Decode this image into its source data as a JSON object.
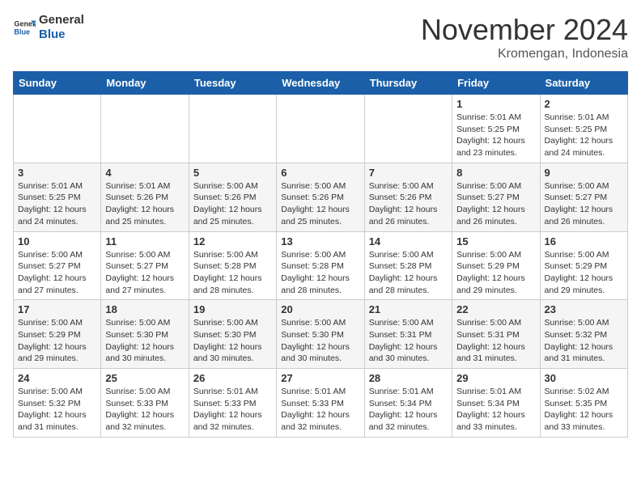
{
  "header": {
    "logo_general": "General",
    "logo_blue": "Blue",
    "month_year": "November 2024",
    "location": "Kromengan, Indonesia"
  },
  "weekdays": [
    "Sunday",
    "Monday",
    "Tuesday",
    "Wednesday",
    "Thursday",
    "Friday",
    "Saturday"
  ],
  "weeks": [
    [
      {
        "day": "",
        "info": ""
      },
      {
        "day": "",
        "info": ""
      },
      {
        "day": "",
        "info": ""
      },
      {
        "day": "",
        "info": ""
      },
      {
        "day": "",
        "info": ""
      },
      {
        "day": "1",
        "info": "Sunrise: 5:01 AM\nSunset: 5:25 PM\nDaylight: 12 hours\nand 23 minutes."
      },
      {
        "day": "2",
        "info": "Sunrise: 5:01 AM\nSunset: 5:25 PM\nDaylight: 12 hours\nand 24 minutes."
      }
    ],
    [
      {
        "day": "3",
        "info": "Sunrise: 5:01 AM\nSunset: 5:25 PM\nDaylight: 12 hours\nand 24 minutes."
      },
      {
        "day": "4",
        "info": "Sunrise: 5:01 AM\nSunset: 5:26 PM\nDaylight: 12 hours\nand 25 minutes."
      },
      {
        "day": "5",
        "info": "Sunrise: 5:00 AM\nSunset: 5:26 PM\nDaylight: 12 hours\nand 25 minutes."
      },
      {
        "day": "6",
        "info": "Sunrise: 5:00 AM\nSunset: 5:26 PM\nDaylight: 12 hours\nand 25 minutes."
      },
      {
        "day": "7",
        "info": "Sunrise: 5:00 AM\nSunset: 5:26 PM\nDaylight: 12 hours\nand 26 minutes."
      },
      {
        "day": "8",
        "info": "Sunrise: 5:00 AM\nSunset: 5:27 PM\nDaylight: 12 hours\nand 26 minutes."
      },
      {
        "day": "9",
        "info": "Sunrise: 5:00 AM\nSunset: 5:27 PM\nDaylight: 12 hours\nand 26 minutes."
      }
    ],
    [
      {
        "day": "10",
        "info": "Sunrise: 5:00 AM\nSunset: 5:27 PM\nDaylight: 12 hours\nand 27 minutes."
      },
      {
        "day": "11",
        "info": "Sunrise: 5:00 AM\nSunset: 5:27 PM\nDaylight: 12 hours\nand 27 minutes."
      },
      {
        "day": "12",
        "info": "Sunrise: 5:00 AM\nSunset: 5:28 PM\nDaylight: 12 hours\nand 28 minutes."
      },
      {
        "day": "13",
        "info": "Sunrise: 5:00 AM\nSunset: 5:28 PM\nDaylight: 12 hours\nand 28 minutes."
      },
      {
        "day": "14",
        "info": "Sunrise: 5:00 AM\nSunset: 5:28 PM\nDaylight: 12 hours\nand 28 minutes."
      },
      {
        "day": "15",
        "info": "Sunrise: 5:00 AM\nSunset: 5:29 PM\nDaylight: 12 hours\nand 29 minutes."
      },
      {
        "day": "16",
        "info": "Sunrise: 5:00 AM\nSunset: 5:29 PM\nDaylight: 12 hours\nand 29 minutes."
      }
    ],
    [
      {
        "day": "17",
        "info": "Sunrise: 5:00 AM\nSunset: 5:29 PM\nDaylight: 12 hours\nand 29 minutes."
      },
      {
        "day": "18",
        "info": "Sunrise: 5:00 AM\nSunset: 5:30 PM\nDaylight: 12 hours\nand 30 minutes."
      },
      {
        "day": "19",
        "info": "Sunrise: 5:00 AM\nSunset: 5:30 PM\nDaylight: 12 hours\nand 30 minutes."
      },
      {
        "day": "20",
        "info": "Sunrise: 5:00 AM\nSunset: 5:30 PM\nDaylight: 12 hours\nand 30 minutes."
      },
      {
        "day": "21",
        "info": "Sunrise: 5:00 AM\nSunset: 5:31 PM\nDaylight: 12 hours\nand 30 minutes."
      },
      {
        "day": "22",
        "info": "Sunrise: 5:00 AM\nSunset: 5:31 PM\nDaylight: 12 hours\nand 31 minutes."
      },
      {
        "day": "23",
        "info": "Sunrise: 5:00 AM\nSunset: 5:32 PM\nDaylight: 12 hours\nand 31 minutes."
      }
    ],
    [
      {
        "day": "24",
        "info": "Sunrise: 5:00 AM\nSunset: 5:32 PM\nDaylight: 12 hours\nand 31 minutes."
      },
      {
        "day": "25",
        "info": "Sunrise: 5:00 AM\nSunset: 5:33 PM\nDaylight: 12 hours\nand 32 minutes."
      },
      {
        "day": "26",
        "info": "Sunrise: 5:01 AM\nSunset: 5:33 PM\nDaylight: 12 hours\nand 32 minutes."
      },
      {
        "day": "27",
        "info": "Sunrise: 5:01 AM\nSunset: 5:33 PM\nDaylight: 12 hours\nand 32 minutes."
      },
      {
        "day": "28",
        "info": "Sunrise: 5:01 AM\nSunset: 5:34 PM\nDaylight: 12 hours\nand 32 minutes."
      },
      {
        "day": "29",
        "info": "Sunrise: 5:01 AM\nSunset: 5:34 PM\nDaylight: 12 hours\nand 33 minutes."
      },
      {
        "day": "30",
        "info": "Sunrise: 5:02 AM\nSunset: 5:35 PM\nDaylight: 12 hours\nand 33 minutes."
      }
    ]
  ]
}
